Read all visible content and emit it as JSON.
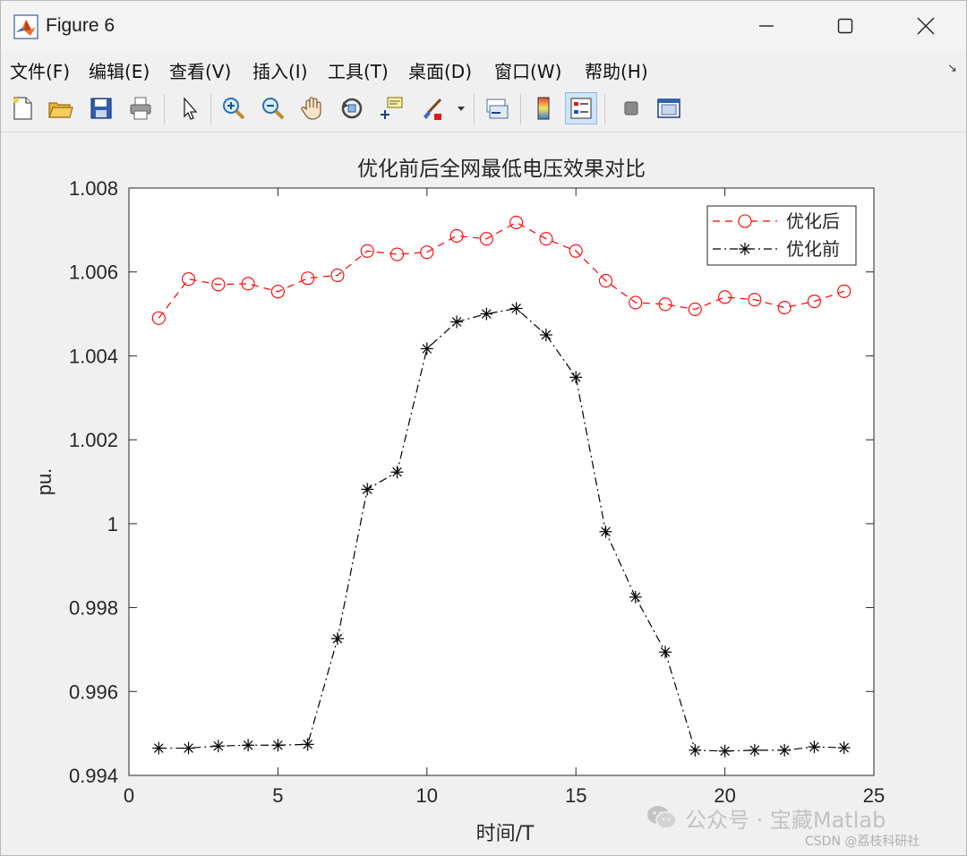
{
  "window": {
    "title": "Figure 6"
  },
  "menu": {
    "items": [
      "文件(F)",
      "编辑(E)",
      "查看(V)",
      "插入(I)",
      "工具(T)",
      "桌面(D)",
      "窗口(W)",
      "帮助(H)"
    ],
    "corner_icon": "undock-arrow-icon"
  },
  "toolbar": {
    "buttons": [
      "new-figure-icon",
      "open-file-icon",
      "save-icon",
      "print-icon",
      "edit-plot-arrow-icon",
      "zoom-in-icon",
      "zoom-out-icon",
      "pan-hand-icon",
      "rotate-3d-icon",
      "data-cursor-icon",
      "brush-icon",
      "brush-dropdown-icon",
      "link-plot-icon",
      "colorbar-icon",
      "legend-icon",
      "hide-plot-tools-icon",
      "show-plot-tools-icon"
    ]
  },
  "chart_data": {
    "type": "line",
    "title": "优化前后全网最低电压效果对比",
    "xlabel": "时间/T",
    "ylabel": "pu.",
    "xlim": [
      0,
      25
    ],
    "ylim": [
      0.994,
      1.008
    ],
    "xticks": [
      "0",
      "5",
      "10",
      "15",
      "20",
      "25"
    ],
    "xtick_values": [
      0,
      5,
      10,
      15,
      20,
      25
    ],
    "yticks": [
      "0.994",
      "0.996",
      "0.998",
      "1",
      "1.002",
      "1.004",
      "1.006",
      "1.008"
    ],
    "ytick_values": [
      0.994,
      0.996,
      0.998,
      1.0,
      1.002,
      1.004,
      1.006,
      1.008
    ],
    "x": [
      1,
      2,
      3,
      4,
      5,
      6,
      7,
      8,
      9,
      10,
      11,
      12,
      13,
      14,
      15,
      16,
      17,
      18,
      19,
      20,
      21,
      22,
      23,
      24
    ],
    "legend_position": "top-right",
    "grid": false,
    "series": [
      {
        "name": "优化后",
        "color": "#ff0000",
        "marker": "circle",
        "line_style": "dashed",
        "values": [
          1.0049,
          1.00583,
          1.0057,
          1.00572,
          1.00553,
          1.00585,
          1.00592,
          1.0065,
          1.00642,
          1.00647,
          1.00686,
          1.00679,
          1.00718,
          1.00679,
          1.0065,
          1.00579,
          1.00527,
          1.00523,
          1.00511,
          1.0054,
          1.00534,
          1.00515,
          1.0053,
          1.00554
        ]
      },
      {
        "name": "优化前",
        "color": "#000000",
        "marker": "asterisk",
        "line_style": "dashdot",
        "values": [
          0.99465,
          0.99465,
          0.9947,
          0.99472,
          0.99472,
          0.99474,
          0.99726,
          1.00082,
          1.00123,
          1.00417,
          1.00481,
          1.005,
          1.00513,
          1.0045,
          1.00349,
          0.99981,
          0.99825,
          0.99694,
          0.9946,
          0.99458,
          0.9946,
          0.9946,
          0.99468,
          0.99466
        ]
      }
    ]
  },
  "watermark": {
    "icon": "wechat-icon",
    "text": "公众号 · 宝藏Matlab",
    "credit": "CSDN @荔枝科研社"
  }
}
